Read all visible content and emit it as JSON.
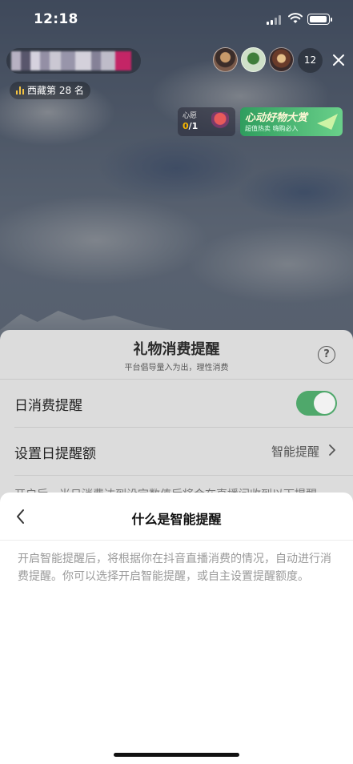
{
  "status_bar": {
    "time": "12:18"
  },
  "live_room": {
    "rank_label": "西藏第 28 名",
    "viewer_count": "12",
    "heart_widget": {
      "title": "心愿",
      "progress_current": "0",
      "progress_total": "/1"
    },
    "promo_widget": {
      "title": "心动好物大赏",
      "subtitle": "超值热卖 嗨购必入"
    }
  },
  "gift_reminder_sheet": {
    "title": "礼物消费提醒",
    "subtitle": "平台倡导量入为出，理性消费",
    "help_label": "?",
    "daily_reminder_label": "日消费提醒",
    "daily_reminder_enabled": true,
    "set_amount_label": "设置日提醒额",
    "set_amount_value": "智能提醒",
    "cut_off_text": "开启后，当日消费达到设定数值后将会在直播间收到以下提醒"
  },
  "smart_reminder_sheet": {
    "title": "什么是智能提醒",
    "body": "开启智能提醒后，将根据你在抖音直播消费的情况，自动进行消费提醒。你可以选择开启智能提醒，或自主设置提醒额度。"
  },
  "colors": {
    "toggle_on": "#4fa86b",
    "promo_green": "#2f9d5e",
    "rank_gold": "#f3c343"
  }
}
